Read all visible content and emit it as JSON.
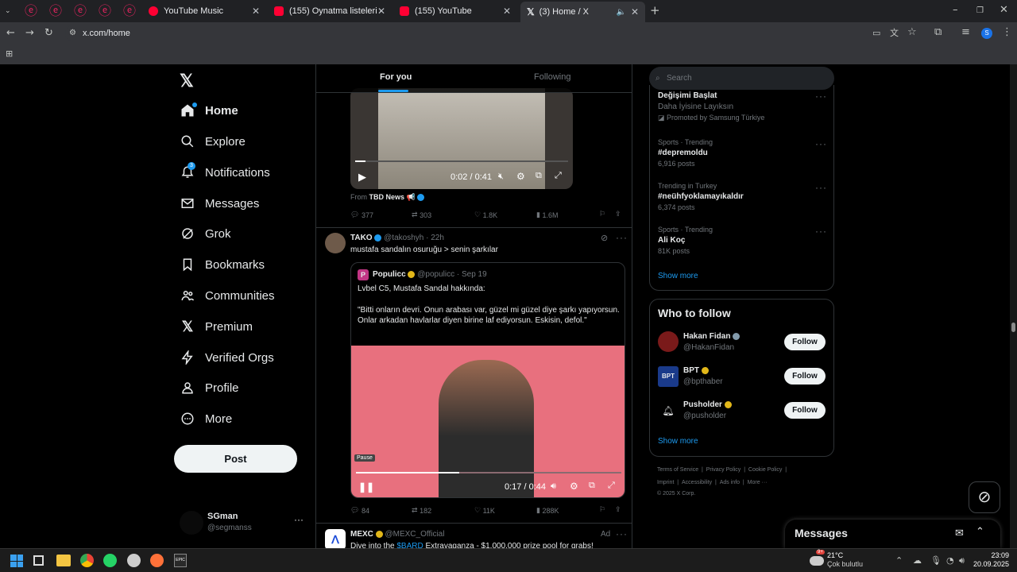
{
  "browser": {
    "tabs": [
      {
        "title": "YouTube Music"
      },
      {
        "title": "(155) Oynatma listeleri - YouTube"
      },
      {
        "title": "(155) YouTube"
      },
      {
        "title": "(3) Home / X"
      }
    ],
    "url": "x.com/home"
  },
  "sidebar": {
    "items": [
      {
        "label": "Home"
      },
      {
        "label": "Explore"
      },
      {
        "label": "Notifications",
        "badge": "3"
      },
      {
        "label": "Messages"
      },
      {
        "label": "Grok"
      },
      {
        "label": "Bookmarks"
      },
      {
        "label": "Communities"
      },
      {
        "label": "Premium"
      },
      {
        "label": "Verified Orgs"
      },
      {
        "label": "Profile"
      },
      {
        "label": "More"
      }
    ],
    "post_label": "Post",
    "account": {
      "name": "SGman",
      "handle": "@segmanss"
    }
  },
  "feed": {
    "tabs": {
      "for_you": "For you",
      "following": "Following"
    },
    "video1": {
      "time": "0:02 / 0:41",
      "progress": 0.05,
      "from_label": "From",
      "from_source": "TBD News",
      "emoji": "📢"
    },
    "post1_actions": {
      "replies": "377",
      "reposts": "303",
      "likes": "1.8K",
      "views": "1.6M"
    },
    "post2": {
      "name": "TAKO",
      "handle": "@takoshyh",
      "time": "· 22h",
      "text": "mustafa sandalın osuruğu > senin şarkılar",
      "quote": {
        "name": "Populicc",
        "handle": "@populicc",
        "time": "· Sep 19",
        "line1": "Lvbel C5, Mustafa Sandal hakkında:",
        "line2": "\"Bitti onların devri. Onun arabası var, güzel mi güzel diye şarkı yapıyorsun. Onlar arkadan havlarlar diyen birine laf ediyorsun. Eskisin, defol.\""
      },
      "video": {
        "time": "0:17 / 0:44",
        "progress": 0.39,
        "tooltip": "Pause"
      },
      "actions": {
        "replies": "84",
        "reposts": "182",
        "likes": "11K",
        "views": "288K"
      }
    },
    "post3": {
      "name": "MEXC",
      "handle": "@MEXC_Official",
      "ad": "Ad",
      "text_a": "Dive into the ",
      "text_link": "$BARD",
      "text_b": " Extravaganza - $1,000,000 prize pool for grabs!"
    }
  },
  "right": {
    "search_placeholder": "Search",
    "trends": [
      {
        "context": "",
        "name": "Değişimi Başlat",
        "sub": "Daha İyisine Layıksın",
        "promo": "Promoted by Samsung Türkiye"
      },
      {
        "context": "Sports · Trending",
        "name": "#depremoldu",
        "sub": "6,916 posts"
      },
      {
        "context": "Trending in Turkey",
        "name": "#neühfyoklamayıkaldır",
        "sub": "6,374 posts"
      },
      {
        "context": "Sports · Trending",
        "name": "Ali Koç",
        "sub": "81K posts"
      }
    ],
    "show_more": "Show more",
    "who_to_follow": {
      "title": "Who to follow",
      "accounts": [
        {
          "name": "Hakan Fidan",
          "handle": "@HakanFidan",
          "badge": "blue"
        },
        {
          "name": "BPT",
          "handle": "@bpthaber",
          "badge": "gold"
        },
        {
          "name": "Pusholder",
          "handle": "@pusholder",
          "badge": "gold"
        }
      ],
      "follow_label": "Follow",
      "show_more": "Show more"
    },
    "footer": {
      "row1": [
        "Terms of Service",
        "Privacy Policy",
        "Cookie Policy"
      ],
      "row2": [
        "Imprint",
        "Accessibility",
        "Ads info",
        "More ···"
      ],
      "copyright": "© 2025 X Corp."
    },
    "messages_drawer": "Messages"
  },
  "taskbar": {
    "weather_temp": "21°C",
    "weather_desc": "Çok bulutlu",
    "weather_badge": "9+",
    "time": "23:09",
    "date": "20.09.2025"
  },
  "colors": {
    "accent": "#1d9bf0",
    "gold": "#e2b719",
    "bg": "#000000"
  }
}
